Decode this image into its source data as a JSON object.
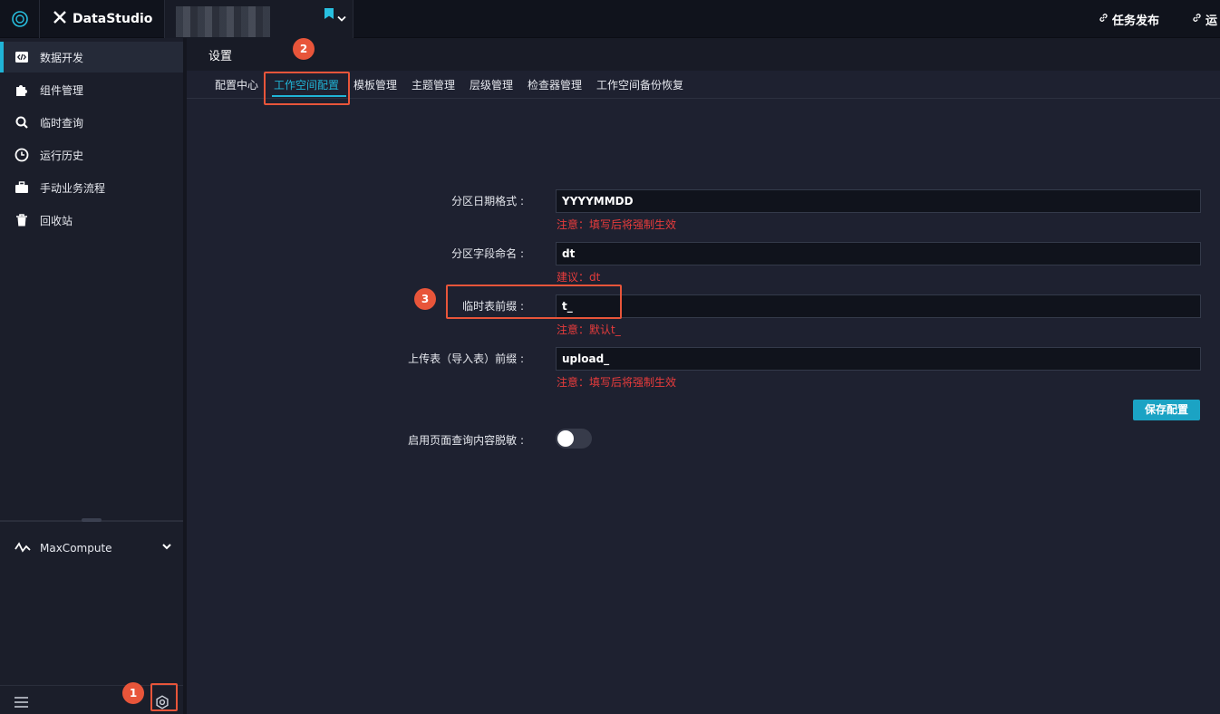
{
  "topbar": {
    "app_name": "DataStudio",
    "workspace_name": "",
    "right_items": [
      {
        "label": "任务发布",
        "icon": "link-icon"
      },
      {
        "label": "运",
        "icon": "link-icon"
      }
    ]
  },
  "sidebar": {
    "items": [
      {
        "label": "数据开发",
        "icon": "code-icon",
        "active": true
      },
      {
        "label": "组件管理",
        "icon": "puzzle-icon"
      },
      {
        "label": "临时查询",
        "icon": "search-icon"
      },
      {
        "label": "运行历史",
        "icon": "clock-icon"
      },
      {
        "label": "手动业务流程",
        "icon": "briefcase-icon"
      },
      {
        "label": "回收站",
        "icon": "trash-icon"
      }
    ],
    "engine": {
      "label": "MaxCompute",
      "icon": "pulse-icon"
    }
  },
  "main": {
    "title": "设置",
    "tabs": [
      {
        "label": "配置中心"
      },
      {
        "label": "工作空间配置",
        "active": true
      },
      {
        "label": "模板管理"
      },
      {
        "label": "主题管理"
      },
      {
        "label": "层级管理"
      },
      {
        "label": "检查器管理"
      },
      {
        "label": "工作空间备份恢复"
      }
    ],
    "form": {
      "partition_date_format": {
        "label": "分区日期格式 :",
        "value": "YYYYMMDD",
        "hint": "注意：填写后将强制生效"
      },
      "partition_field_name": {
        "label": "分区字段命名 :",
        "value": "dt",
        "hint": "建议：dt"
      },
      "temp_table_prefix": {
        "label": "临时表前缀 :",
        "value": "t_",
        "hint": "注意：默认t_"
      },
      "upload_table_prefix": {
        "label": "上传表（导入表）前缀 :",
        "value": "upload_",
        "hint": "注意：填写后将强制生效"
      },
      "save_label": "保存配置",
      "masking": {
        "label": "启用页面查询内容脱敏 :",
        "enabled": false
      }
    }
  },
  "annotations": [
    "1",
    "2",
    "3"
  ],
  "colors": {
    "accent": "#20b4d6",
    "annotation": "#e8553a",
    "warning": "#e83c3c",
    "background": "#1e2130"
  }
}
